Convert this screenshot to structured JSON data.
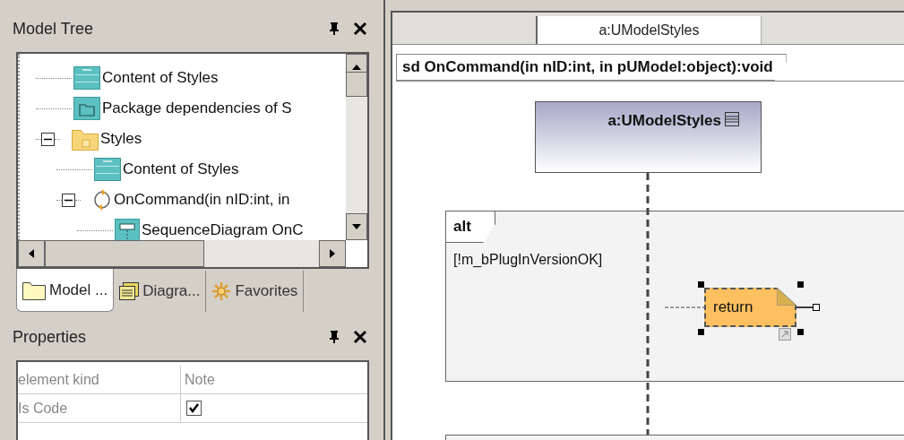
{
  "model_tree": {
    "title": "Model Tree",
    "items": [
      {
        "label": "Content of Styles",
        "kind": "class"
      },
      {
        "label": "Package dependencies of S",
        "kind": "package"
      },
      {
        "label": "Styles",
        "kind": "folder",
        "expanded": true,
        "children": [
          {
            "label": "Content of Styles",
            "kind": "class"
          },
          {
            "label": "OnCommand(in nID:int, in",
            "kind": "operation",
            "expanded": true,
            "children": [
              {
                "label": "SequenceDiagram OnC",
                "kind": "diagram"
              }
            ]
          }
        ]
      }
    ]
  },
  "panel_tabs": [
    {
      "label": "Model ...",
      "kind": "folder",
      "selected": true
    },
    {
      "label": "Diagra...",
      "kind": "diagram",
      "selected": false
    },
    {
      "label": "Favorites",
      "kind": "star",
      "selected": false
    }
  ],
  "properties": {
    "title": "Properties",
    "rows": [
      {
        "name": "element kind",
        "kind": "text",
        "value": "Note"
      },
      {
        "name": "Is Code",
        "kind": "checkbox",
        "checked": true
      }
    ]
  },
  "diagram": {
    "tabs": [
      {
        "label": "a:UModelStyles",
        "selected": true
      }
    ],
    "frame_title": "sd OnCommand(in nID:int, in pUModel:object):void",
    "lifeline": "a:UModelStyles",
    "fragment": {
      "operator": "alt",
      "guard": "[!m_bPlugInVersionOK]"
    },
    "note": {
      "text": "return",
      "selected": true
    }
  }
}
